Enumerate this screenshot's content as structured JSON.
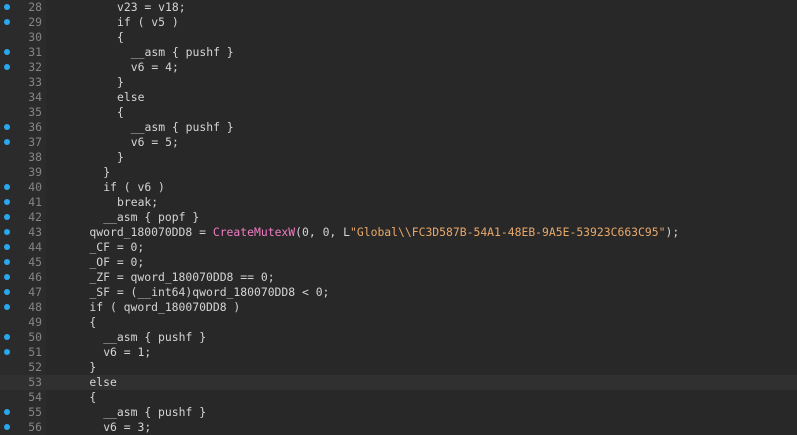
{
  "editor": {
    "colors": {
      "background": "#282828",
      "line_number": "#858585",
      "breakpoint": "#29a8f0",
      "function": "#f07cc4",
      "string": "#e8a86a",
      "text": "#d4d4d4"
    },
    "lines": [
      {
        "num": "28",
        "bp": true,
        "tokens": [
          {
            "t": "v23 = v18;",
            "c": "id"
          }
        ]
      },
      {
        "num": "29",
        "bp": true,
        "tokens": [
          {
            "t": "if ( v5 )",
            "c": "kw"
          }
        ]
      },
      {
        "num": "30",
        "bp": false,
        "tokens": [
          {
            "t": "{",
            "c": "pun"
          }
        ]
      },
      {
        "num": "31",
        "bp": true,
        "tokens": [
          {
            "t": "__asm { pushf }",
            "c": "kw"
          }
        ]
      },
      {
        "num": "32",
        "bp": true,
        "tokens": [
          {
            "t": "v6 = 4;",
            "c": "id"
          }
        ]
      },
      {
        "num": "33",
        "bp": false,
        "tokens": [
          {
            "t": "}",
            "c": "pun"
          }
        ]
      },
      {
        "num": "34",
        "bp": false,
        "tokens": [
          {
            "t": "else",
            "c": "kw"
          }
        ]
      },
      {
        "num": "35",
        "bp": false,
        "tokens": [
          {
            "t": "{",
            "c": "pun"
          }
        ]
      },
      {
        "num": "36",
        "bp": true,
        "tokens": [
          {
            "t": "__asm { pushf }",
            "c": "kw"
          }
        ]
      },
      {
        "num": "37",
        "bp": true,
        "tokens": [
          {
            "t": "v6 = 5;",
            "c": "id"
          }
        ]
      },
      {
        "num": "38",
        "bp": false,
        "tokens": [
          {
            "t": "}",
            "c": "pun"
          }
        ]
      },
      {
        "num": "39",
        "bp": false,
        "tokens": [
          {
            "t": "}",
            "c": "pun"
          }
        ]
      },
      {
        "num": "40",
        "bp": true,
        "tokens": [
          {
            "t": "if ( v6 )",
            "c": "kw"
          }
        ]
      },
      {
        "num": "41",
        "bp": true,
        "tokens": [
          {
            "t": "break;",
            "c": "kw"
          }
        ]
      },
      {
        "num": "42",
        "bp": true,
        "tokens": [
          {
            "t": "__asm { popf }",
            "c": "kw"
          }
        ]
      },
      {
        "num": "43",
        "bp": true,
        "tokens": [
          {
            "t": "qword_180070DD8 = ",
            "c": "id"
          },
          {
            "t": "CreateMutexW",
            "c": "fn"
          },
          {
            "t": "(0, 0, L",
            "c": "id"
          },
          {
            "t": "\"Global\\\\FC3D587B-54A1-48EB-9A5E-53923C663C95\"",
            "c": "str"
          },
          {
            "t": ");",
            "c": "pun"
          }
        ]
      },
      {
        "num": "44",
        "bp": true,
        "tokens": [
          {
            "t": "_CF = 0;",
            "c": "id"
          }
        ]
      },
      {
        "num": "45",
        "bp": true,
        "tokens": [
          {
            "t": "_OF = 0;",
            "c": "id"
          }
        ]
      },
      {
        "num": "46",
        "bp": true,
        "tokens": [
          {
            "t": "_ZF = qword_180070DD8 == 0;",
            "c": "id"
          }
        ]
      },
      {
        "num": "47",
        "bp": true,
        "tokens": [
          {
            "t": "_SF = (__int64)qword_180070DD8 < 0;",
            "c": "id"
          }
        ]
      },
      {
        "num": "48",
        "bp": true,
        "tokens": [
          {
            "t": "if ( qword_180070DD8 )",
            "c": "kw"
          }
        ]
      },
      {
        "num": "49",
        "bp": false,
        "tokens": [
          {
            "t": "{",
            "c": "pun"
          }
        ]
      },
      {
        "num": "50",
        "bp": true,
        "tokens": [
          {
            "t": "__asm { pushf }",
            "c": "kw"
          }
        ]
      },
      {
        "num": "51",
        "bp": true,
        "tokens": [
          {
            "t": "v6 = 1;",
            "c": "id"
          }
        ]
      },
      {
        "num": "52",
        "bp": false,
        "tokens": [
          {
            "t": "}",
            "c": "pun"
          }
        ]
      },
      {
        "num": "53",
        "bp": false,
        "tokens": [
          {
            "t": "else",
            "c": "kw"
          }
        ]
      },
      {
        "num": "54",
        "bp": false,
        "tokens": [
          {
            "t": "{",
            "c": "pun"
          }
        ]
      },
      {
        "num": "55",
        "bp": true,
        "tokens": [
          {
            "t": "__asm { pushf }",
            "c": "kw"
          }
        ]
      },
      {
        "num": "56",
        "bp": true,
        "tokens": [
          {
            "t": "v6 = 3;",
            "c": "id"
          }
        ]
      }
    ]
  }
}
